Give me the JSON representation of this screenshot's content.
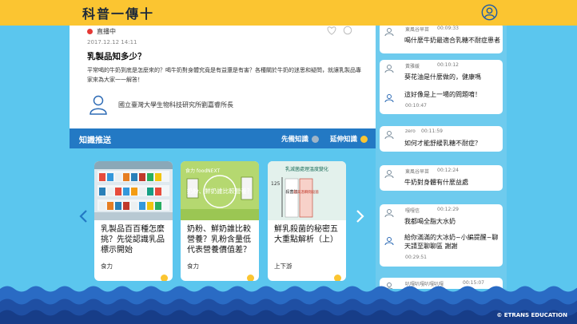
{
  "header": {
    "logo": "科普一傳十",
    "logo_sub": "科普一傳十",
    "colors": {
      "header_bg": "#fbc531",
      "accent": "#2379c4"
    }
  },
  "article": {
    "live_label": "直播中",
    "date": "2017.12.12 14:11",
    "title": "乳製品知多少？",
    "description": "平常喝的牛奶到底是怎麼來的？喝牛奶對身體究竟是有益還是有害？各種關於牛奶的迷思和疑問，就讓乳製品專家來為大家一一解答！",
    "expert": "國立臺灣大學生物科技研究所劉嘉睿所長"
  },
  "knowledge": {
    "title": "知識推送",
    "option_prior": "先備知識",
    "option_extend": "延伸知識",
    "cards": [
      {
        "title": "乳製品百百種怎麼挑？先從認識乳品標示開始",
        "source": "食力"
      },
      {
        "title": "奶粉、鮮奶誰比較營養？乳粉含量低代表營養價值差？",
        "source": "食力",
        "thumb_text": "奶粉、鮮奶誰比較營養？",
        "thumb_brand": "食力 foodNEXT"
      },
      {
        "title": "鮮乳殺菌的秘密五大重點解析（上）",
        "source": "上下游",
        "thumb_text": "乳滅菌處理溫度變化",
        "thumb_axis": "125",
        "thumb_col1": "殺菌法",
        "thumb_col2": "超高溫瞬間殺菌"
      }
    ]
  },
  "chat": {
    "messages": [
      {
        "name": "東風谷早苗",
        "time": "00:09:33",
        "text": "喝什麼牛奶最適合乳糖不耐症患者"
      },
      {
        "name": "黃雅媛",
        "time": "00:10:12",
        "text": "葵花油是什麼做的，健康嗎",
        "reply_text": "這好像是上一場的問題唷！",
        "reply_time": "00:10:47"
      },
      {
        "name": "zero",
        "time": "00:11:59",
        "text": "如何才能舒緩乳糖不耐症？"
      },
      {
        "name": "東風谷早苗",
        "time": "00:12:24",
        "text": "牛奶對身體有什麼益處"
      },
      {
        "name": "嘎嘎信",
        "time": "00:12:29",
        "text": "我都喝全脂大水奶",
        "reply_text": "給你滿滿的大冰奶~小編提醒~聊天請至聊聊區 謝謝",
        "reply_time": "00:29:51"
      },
      {
        "name": "叭嘎叭嘎叭嘎叭嘎",
        "time": "00:15:07",
        "text": ""
      }
    ]
  },
  "footer": {
    "copyright": "© ETRANS EDUCATION"
  }
}
